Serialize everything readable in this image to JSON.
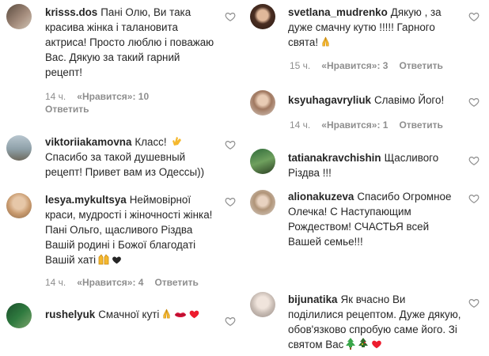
{
  "left": [
    {
      "user": "krisss.dos",
      "text": "Пані Олю, Ви така красива жінка і талановита актриса! Просто люблю і поважаю Вас. Дякую за такий гарний рецепт!",
      "time": "14 ч.",
      "likes": "«Нравится»: 10",
      "reply": "Ответить"
    },
    {
      "user": "viktoriiakamovna",
      "text": "Класс!",
      "text2": "Спасибо за такой душевный рецепт! Привет вам из Одессы))",
      "emoji": [
        "clap-hands"
      ],
      "time": "",
      "likes": "",
      "reply": ""
    },
    {
      "user": "lesya.mykultsya",
      "text": "Неймовірної краси, мудрості і жіночності жінка! Пані Ольго, щасливого Різдва Вашій родині і Божої благодаті Вашій хаті",
      "emoji": [
        "raised-hands",
        "black-heart"
      ],
      "time": "14 ч.",
      "likes": "«Нравится»: 4",
      "reply": "Ответить"
    },
    {
      "user": "rushelyuk",
      "text": "Смачної куті",
      "emoji": [
        "folded-hands",
        "lips",
        "red-heart"
      ],
      "time": "",
      "likes": "",
      "reply": ""
    }
  ],
  "right": [
    {
      "user": "svetlana_mudrenko",
      "text": "Дякую , за дуже смачну кутю !!!!! Гарного свята!",
      "emoji": [
        "folded-hands"
      ],
      "time": "15 ч.",
      "likes": "«Нравится»: 3",
      "reply": "Ответить"
    },
    {
      "user": "ksyuhagavryliuk",
      "text": "Славімо Його!",
      "time": "14 ч.",
      "likes": "«Нравится»: 1",
      "reply": "Ответить"
    },
    {
      "user": "tatianakravchishin",
      "text": "Щасливого Різдва !!!",
      "time": "",
      "likes": "",
      "reply": ""
    },
    {
      "user": "alionakuzeva",
      "text": "Спасибо Огромное Олечка! С Наступающим Рождеством! СЧАСТЬЯ всей Вашей семье!!!",
      "time": "",
      "likes": "",
      "reply": ""
    },
    {
      "user": "bijunatika",
      "text": "Як вчасно Ви поділилися рецептом. Дуже дякую, обов'язково спробую саме його. Зі святом Вас",
      "emoji": [
        "christmas-tree",
        "christmas-tree-dark",
        "red-heart"
      ],
      "time": "",
      "likes": "",
      "reply": ""
    }
  ],
  "colors": {
    "text": "#262626",
    "meta": "#8e8e8e",
    "heart_outline": "#8e8e8e",
    "red": "#ed1c2e"
  }
}
